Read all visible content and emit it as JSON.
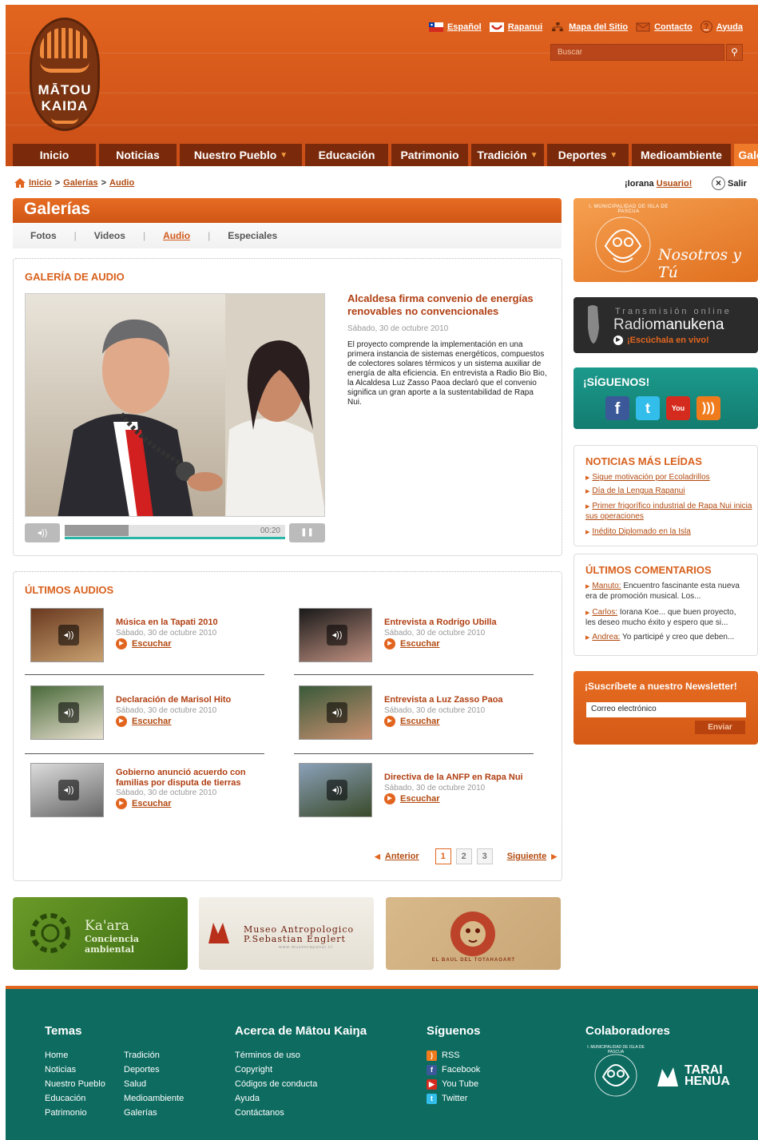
{
  "header": {
    "logo_line1": "MĀTOU",
    "logo_line2": "KAIŊA",
    "top_links": [
      "Español",
      "Rapanui",
      "Mapa del Sitio",
      "Contacto",
      "Ayuda"
    ],
    "search_placeholder": "Buscar",
    "nav": [
      {
        "label": "Inicio"
      },
      {
        "label": "Noticias"
      },
      {
        "label": "Nuestro Pueblo",
        "arrow": "▼"
      },
      {
        "label": "Educación"
      },
      {
        "label": "Patrimonio"
      },
      {
        "label": "Tradición",
        "arrow": "▼"
      },
      {
        "label": "Deportes",
        "arrow": "▼"
      },
      {
        "label": "Medioambiente"
      },
      {
        "label": "Galerías",
        "arrow": "▼"
      }
    ]
  },
  "breadcrumb": {
    "home": "Inicio",
    "sep": ">",
    "galerias": "Galerías",
    "audio": "Audio"
  },
  "user": {
    "greeting": "¡Iorana",
    "name": "Usuario!",
    "logout": "Salir"
  },
  "page": {
    "title": "Galerías",
    "subnav": [
      "Fotos",
      "Videos",
      "Audio",
      "Especiales"
    ]
  },
  "gallery": {
    "heading": "GALERÍA DE AUDIO",
    "player_time": "00:20",
    "progress": 0.29,
    "featured": {
      "title": "Alcaldesa firma convenio de energías renovables no convencionales",
      "date": "Sábado, 30 de octubre 2010",
      "body": "El proyecto comprende la implementación en una primera instancia de sistemas energéticos, compuestos de colectores solares térmicos y un sistema auxiliar de energía de alta eficiencia. En entrevista a Radio Bio Bio, la Alcaldesa Luz Zasso Paoa declaró que el convenio significa un gran aporte a la sustentabilidad de Rapa Nui."
    }
  },
  "latest": {
    "heading": "ÚLTIMOS AUDIOS",
    "listen_label": "Escuchar",
    "items": [
      {
        "title": "Música en la Tapati 2010",
        "date": "Sábado, 30 de octubre 2010"
      },
      {
        "title": "Entrevista a Rodrigo Ubilla",
        "date": "Sábado, 30 de octubre 2010"
      },
      {
        "title": "Declaración de Marisol Hito",
        "date": "Sábado, 30 de octubre 2010"
      },
      {
        "title": "Entrevista a Luz Zasso Paoa",
        "date": "Sábado, 30 de octubre 2010"
      },
      {
        "title": "Gobierno anunció acuerdo con familias por disputa de tierras",
        "date": "Sábado, 30 de octubre 2010"
      },
      {
        "title": "Directiva de la ANFP en Rapa Nui",
        "date": "Sábado, 30 de octubre 2010"
      }
    ],
    "pager": {
      "prev": "Anterior",
      "pages": [
        "1",
        "2",
        "3"
      ],
      "next": "Siguiente"
    }
  },
  "sidebar": {
    "muni_arc": "I. MUNICIPALIDAD DE ISLA DE PASCUA",
    "muni_script": "Nosotros y Tú",
    "radio_top": "Transmisión online",
    "radio_name1": "Radio",
    "radio_name2": "manukena",
    "radio_live": "¡Escúchala en vivo!",
    "follow_heading": "¡SÍGUENOS!",
    "most_read_heading": "NOTICIAS MÁS LEÍDAS",
    "most_read": [
      "Sigue motivación por Ecoladrillos",
      "Día de la Lengua Rapanui",
      "Primer frigorífico industrial de Rapa Nui inicia sus operaciones",
      "Inédito Diplomado en la Isla"
    ],
    "comments_heading": "ÚLTIMOS COMENTARIOS",
    "comments": [
      {
        "author": "Manuto:",
        "text": "Encuentro fascinante esta nueva era de promoción musical. Los..."
      },
      {
        "author": "Carlos:",
        "text": "Iorana Koe... que buen proyecto, les deseo mucho éxito y espero que si..."
      },
      {
        "author": "Andrea:",
        "text": "Yo participé y creo que deben..."
      }
    ],
    "newsletter_heading": "¡Suscríbete a nuestro Newsletter!",
    "newsletter_placeholder": "Correo electrónico",
    "newsletter_button": "Enviar"
  },
  "ads": {
    "kaara_title": "Ka'ara",
    "kaara_sub": "Conciencia ambiental",
    "museo_line1": "Museo Antropologico",
    "museo_line2": "P.Sebastian Englert",
    "museo_url": "www.museorapanui.cl",
    "baul": "EL BAUL DEL TOTAHAOART"
  },
  "footer": {
    "temas_heading": "Temas",
    "temas_col1": [
      "Home",
      "Noticias",
      "Nuestro Pueblo",
      "Educación",
      "Patrimonio"
    ],
    "temas_col2": [
      "Tradición",
      "Deportes",
      "Salud",
      "Medioambiente",
      "Galerías"
    ],
    "about_heading": "Acerca de Mātou Kaiŋa",
    "about": [
      "Términos de uso",
      "Copyright",
      "Códigos de conducta",
      "Ayuda",
      "Contáctanos"
    ],
    "follow_heading": "Síguenos",
    "follow": [
      "RSS",
      "Facebook",
      "You Tube",
      "Twitter"
    ],
    "collab_heading": "Colaboradores",
    "collab_arc": "I. MUNICIPALIDAD DE ISLA DE PASCUA",
    "tarai_1": "TARAI",
    "tarai_2": "HENUA"
  },
  "colors": {
    "brand_orange": "#e2651f",
    "dark_brown": "#7a2a0b",
    "teal": "#0d6b60"
  }
}
